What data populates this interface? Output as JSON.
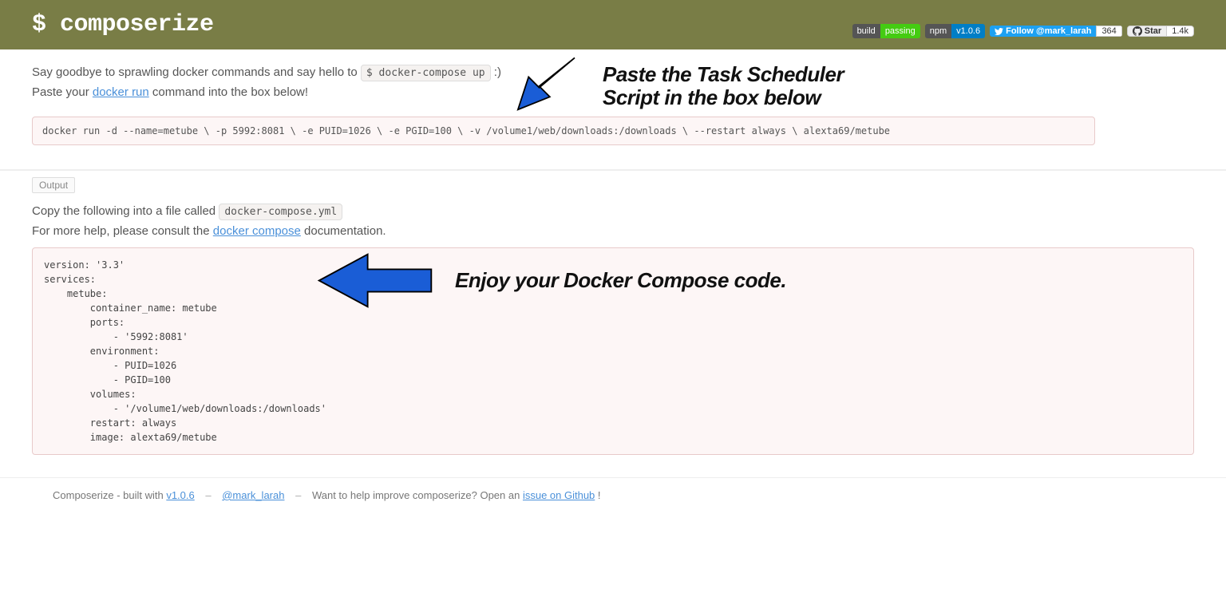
{
  "header": {
    "title": "$ composerize",
    "badges": {
      "build": {
        "left": "build",
        "right": "passing"
      },
      "npm": {
        "left": "npm",
        "right": "v1.0.6"
      },
      "twitter": {
        "label": "Follow @mark_larah",
        "count": "364"
      },
      "github": {
        "label": "Star",
        "count": "1.4k"
      }
    }
  },
  "intro": {
    "line1_pre": "Say goodbye to sprawling docker commands and say hello to ",
    "line1_code": "$ docker-compose up",
    "line1_post": " :)",
    "line2_pre": "Paste your ",
    "line2_link": "docker run",
    "line2_post": " command into the box below!"
  },
  "input_value": "docker run -d --name=metube \\ -p 5992:8081 \\ -e PUID=1026 \\ -e PGID=100 \\ -v /volume1/web/downloads:/downloads \\ --restart always \\ alexta69/metube",
  "annotation1_lines": [
    "Paste the Task Scheduler",
    "Script in the box below"
  ],
  "output": {
    "tab": "Output",
    "copy_pre": "Copy the following into a file called ",
    "copy_code": "docker-compose.yml",
    "help_pre": "For more help, please consult the ",
    "help_link": "docker compose",
    "help_post": " documentation.",
    "code": "version: '3.3'\nservices:\n    metube:\n        container_name: metube\n        ports:\n            - '5992:8081'\n        environment:\n            - PUID=1026\n            - PGID=100\n        volumes:\n            - '/volume1/web/downloads:/downloads'\n        restart: always\n        image: alexta69/metube"
  },
  "annotation2": "Enjoy your Docker Compose code.",
  "footer": {
    "pre": "Composerize - built with ",
    "link1": "v1.0.6",
    "mid1": "@mark_larah",
    "q": "Want to help improve composerize? Open an ",
    "link2": "issue on Github",
    "excl": "!"
  }
}
